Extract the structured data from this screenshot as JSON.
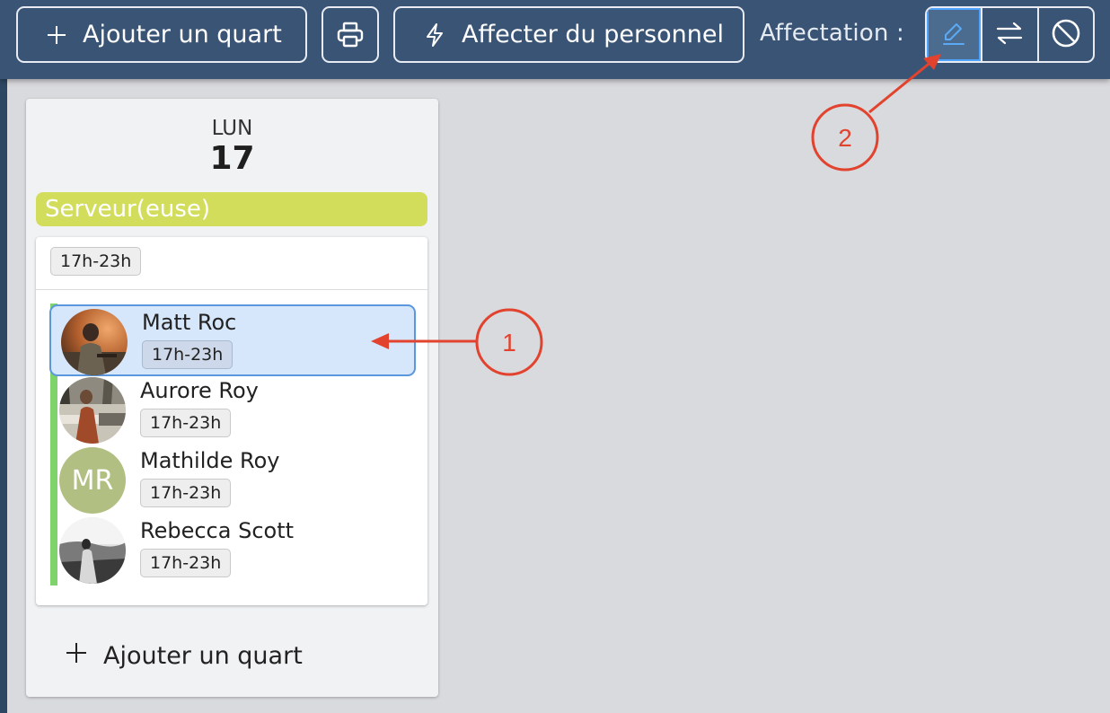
{
  "toolbar": {
    "add_shift_label": "Ajouter un quart",
    "add_icon": "plus-icon",
    "print_icon": "printer-icon",
    "assign_staff_label": "Affecter du personnel",
    "assign_icon": "lightning-icon",
    "assignment_label": "Affectation :",
    "assignment_modes": [
      {
        "icon": "pencil-icon",
        "active": true
      },
      {
        "icon": "swap-arrows-icon",
        "active": false
      },
      {
        "icon": "ban-icon",
        "active": false
      }
    ]
  },
  "day": {
    "name": "LUN",
    "number": "17",
    "role": {
      "label": "Serveur(euse)",
      "color": "#d3dd5c"
    },
    "shift": {
      "time": "17h-23h",
      "assignees": [
        {
          "name": "Matt Roc",
          "time": "17h-23h",
          "avatar": "photo",
          "selected": true
        },
        {
          "name": "Aurore Roy",
          "time": "17h-23h",
          "avatar": "photo",
          "selected": false
        },
        {
          "name": "Mathilde Roy",
          "time": "17h-23h",
          "avatar": "initials",
          "initials": "MR",
          "selected": false
        },
        {
          "name": "Rebecca Scott",
          "time": "17h-23h",
          "avatar": "photo",
          "selected": false
        }
      ]
    },
    "add_shift_label": "Ajouter un quart"
  },
  "annotations": {
    "callout_1": "1",
    "callout_2": "2",
    "color": "#e2432e"
  },
  "colors": {
    "toolbar_bg": "#3a5475",
    "selection_bg": "#d6e6fb",
    "selection_border": "#5a97dd",
    "assigned_bar": "#7ed46a"
  }
}
